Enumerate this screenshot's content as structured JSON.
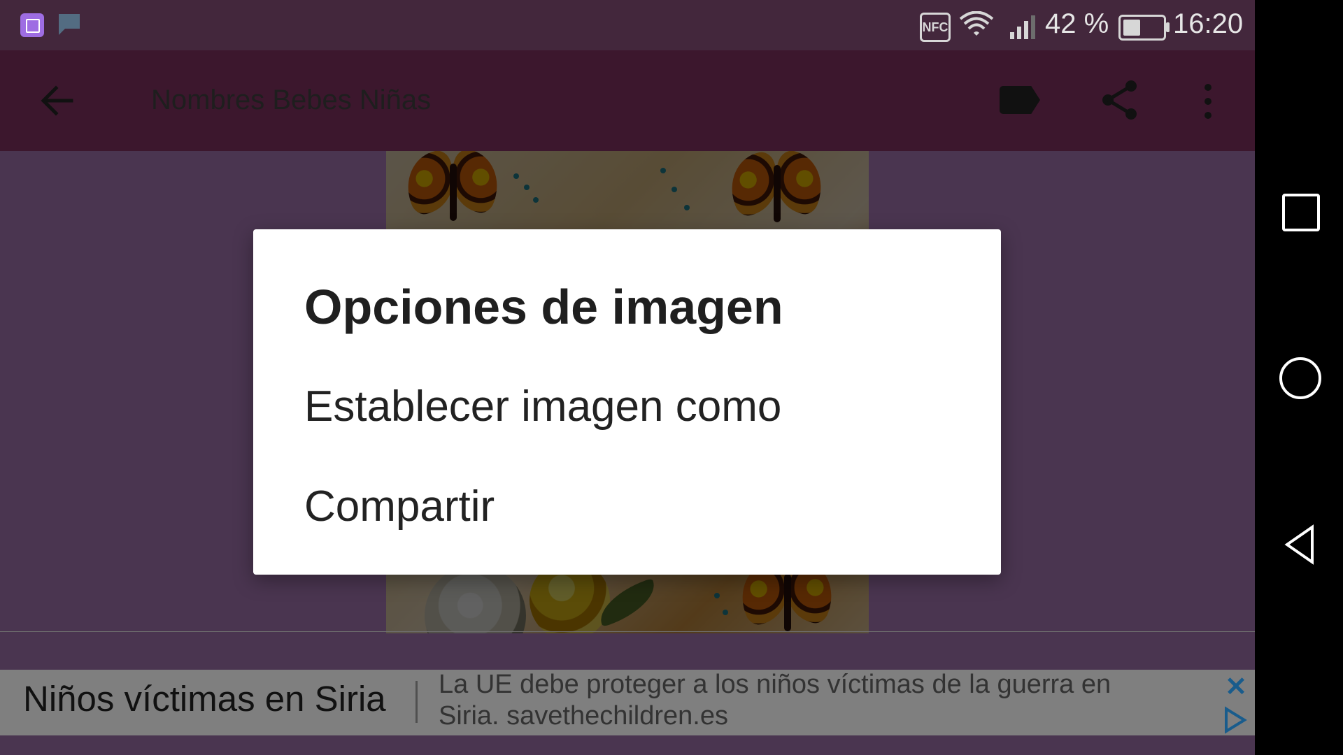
{
  "status_bar": {
    "nfc_label": "NFC",
    "battery_percent": "42 %",
    "time": "16:20",
    "icons": [
      "gallery-icon",
      "chart-flag-icon",
      "nfc-icon",
      "wifi-icon",
      "signal-icon",
      "battery-icon"
    ]
  },
  "app_bar": {
    "title": "Nombres Bebes Niñas",
    "icons": [
      "back-arrow-icon",
      "tag-icon",
      "share-icon",
      "more-options-icon"
    ]
  },
  "dialog": {
    "title": "Opciones de imagen",
    "options": [
      "Establecer imagen como",
      "Compartir"
    ]
  },
  "ad": {
    "title": "Niños víctimas en Siria",
    "text": "La UE debe proteger a los niños víctimas de la guerra en Siria. savethechildren.es",
    "close_icon": "close-icon",
    "play_icon": "ad-choices-play-icon"
  },
  "nav_bar": {
    "icons": [
      "recent-apps-icon",
      "home-icon",
      "back-icon"
    ]
  },
  "colors": {
    "app_bar": "#9d3e78",
    "status_bar": "#b0669d",
    "content": "#c38bd2",
    "ad_link": "#195c8c"
  }
}
